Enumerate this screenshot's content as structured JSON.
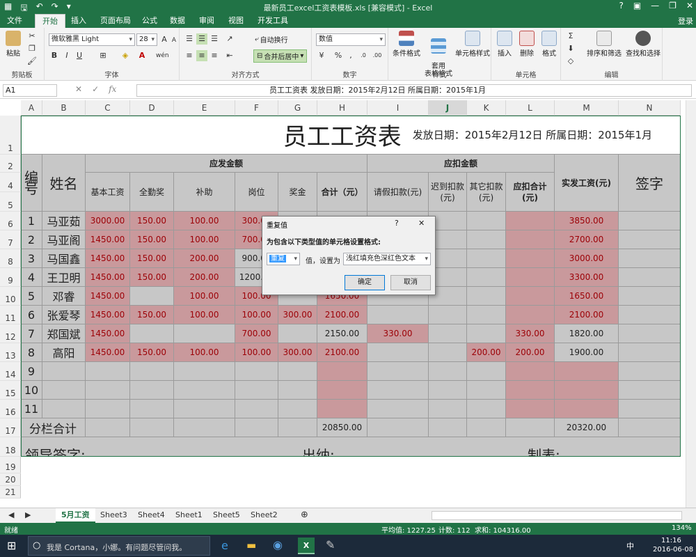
{
  "window": {
    "title": "最新员工excel工资表模板.xls [兼容模式] - Excel",
    "login": "登录"
  },
  "tabs": [
    "开始",
    "插入",
    "页面布局",
    "公式",
    "数据",
    "审阅",
    "视图",
    "开发工具"
  ],
  "file_tab": "文件",
  "ribbon": {
    "clipboard": {
      "label": "剪贴板",
      "paste": "粘贴"
    },
    "font": {
      "label": "字体",
      "name": "微软雅黑 Light",
      "size": "28"
    },
    "alignment": {
      "label": "对齐方式",
      "wrap": "自动换行",
      "merge": "合并后居中"
    },
    "number": {
      "label": "数字",
      "format": "数值"
    },
    "styles": {
      "label": "样式",
      "cond": "条件格式",
      "table": "套用\n表格格式",
      "cell": "单元格样式"
    },
    "cells": {
      "label": "单元格",
      "insert": "插入",
      "delete": "删除",
      "format": "格式"
    },
    "editing": {
      "label": "编辑",
      "sort": "排序和筛选",
      "find": "查找和选择"
    }
  },
  "formula_bar": {
    "namebox": "A1",
    "content": "员工工资表   发放日期：2015年2月12日  所属日期：2015年1月"
  },
  "columns": [
    "A",
    "B",
    "C",
    "D",
    "E",
    "F",
    "G",
    "H",
    "I",
    "J",
    "K",
    "L",
    "M",
    "N"
  ],
  "rows": [
    "1",
    "2",
    "4",
    "5",
    "6",
    "7",
    "8",
    "9",
    "10",
    "11",
    "12",
    "13",
    "14",
    "15",
    "16",
    "17",
    "18",
    "19",
    "20",
    "21"
  ],
  "sheet": {
    "title": "员工工资表",
    "subtitle": "发放日期：2015年2月12日 所属日期：2015年1月",
    "h_id": "编号",
    "h_name": "姓名",
    "h_payable": "应发金额",
    "h_deduct": "应扣金额",
    "h_base": "基本工资",
    "h_attend": "全勤奖",
    "h_subsidy": "补助",
    "h_post": "岗位",
    "h_bonus": "奖金",
    "h_total": "合计（元）",
    "h_leave": "请假扣款(元)",
    "h_late": "迟到扣款(元)",
    "h_other": "其它扣款(元)",
    "h_dtotal": "应扣合计(元)",
    "h_net": "实发工资(元)",
    "h_sign": "签字",
    "sum_label": "分栏合计",
    "sum_total": "20850.00",
    "sum_net": "20320.00",
    "footer": {
      "leader": "领导签字:",
      "cashier": "出纳:",
      "maker": "制表:"
    },
    "data": [
      {
        "id": "1",
        "name": "马亚茹",
        "base": "3000.00",
        "attend": "150.00",
        "subsidy": "100.00",
        "post": "300.00",
        "bonus": "",
        "total": "",
        "leave": "",
        "late": "",
        "other": "",
        "dtotal": "",
        "net": "3850.00"
      },
      {
        "id": "2",
        "name": "马亚阁",
        "base": "1450.00",
        "attend": "150.00",
        "subsidy": "100.00",
        "post": "700.00",
        "bonus": "",
        "total": "",
        "leave": "",
        "late": "",
        "other": "",
        "dtotal": "",
        "net": "2700.00"
      },
      {
        "id": "3",
        "name": "马国鑫",
        "base": "1450.00",
        "attend": "150.00",
        "subsidy": "200.00",
        "post": "900.00",
        "bonus": "",
        "total": "",
        "leave": "",
        "late": "",
        "other": "",
        "dtotal": "",
        "net": "3000.00"
      },
      {
        "id": "4",
        "name": "王卫明",
        "base": "1450.00",
        "attend": "150.00",
        "subsidy": "200.00",
        "post": "1200.00",
        "bonus": "",
        "total": "",
        "leave": "",
        "late": "",
        "other": "",
        "dtotal": "",
        "net": "3300.00"
      },
      {
        "id": "5",
        "name": "邓睿",
        "base": "1450.00",
        "attend": "",
        "subsidy": "100.00",
        "post": "100.00",
        "bonus": "",
        "total": "1650.00",
        "leave": "",
        "late": "",
        "other": "",
        "dtotal": "",
        "net": "1650.00"
      },
      {
        "id": "6",
        "name": "张爱琴",
        "base": "1450.00",
        "attend": "150.00",
        "subsidy": "100.00",
        "post": "100.00",
        "bonus": "300.00",
        "total": "2100.00",
        "leave": "",
        "late": "",
        "other": "",
        "dtotal": "",
        "net": "2100.00"
      },
      {
        "id": "7",
        "name": "郑国斌",
        "base": "1450.00",
        "attend": "",
        "subsidy": "",
        "post": "700.00",
        "bonus": "",
        "total": "2150.00",
        "leave": "330.00",
        "late": "",
        "other": "",
        "dtotal": "330.00",
        "net": "1820.00"
      },
      {
        "id": "8",
        "name": "高阳",
        "base": "1450.00",
        "attend": "150.00",
        "subsidy": "100.00",
        "post": "100.00",
        "bonus": "300.00",
        "total": "2100.00",
        "leave": "",
        "late": "",
        "other": "200.00",
        "dtotal": "200.00",
        "net": "1900.00"
      },
      {
        "id": "9",
        "name": "",
        "base": "",
        "attend": "",
        "subsidy": "",
        "post": "",
        "bonus": "",
        "total": "",
        "leave": "",
        "late": "",
        "other": "",
        "dtotal": "",
        "net": ""
      },
      {
        "id": "10",
        "name": "",
        "base": "",
        "attend": "",
        "subsidy": "",
        "post": "",
        "bonus": "",
        "total": "",
        "leave": "",
        "late": "",
        "other": "",
        "dtotal": "",
        "net": ""
      },
      {
        "id": "11",
        "name": "",
        "base": "",
        "attend": "",
        "subsidy": "",
        "post": "",
        "bonus": "",
        "total": "",
        "leave": "",
        "late": "",
        "other": "",
        "dtotal": "",
        "net": ""
      }
    ]
  },
  "sheet_tabs": [
    "5月工资",
    "Sheet3",
    "Sheet4",
    "Sheet1",
    "Sheet5",
    "Sheet2"
  ],
  "status": {
    "ready": "就绪",
    "avg": "平均值: 1227.25",
    "count": "计数: 112",
    "sum": "求和: 104316.00",
    "zoom": "134%"
  },
  "taskbar": {
    "search": "我是 Cortana，小娜。有问题尽管问我。",
    "time": "11:16",
    "date": "2016-06-08",
    "ime": "中"
  },
  "dialog": {
    "title": "重复值",
    "help": "?",
    "close": "✕",
    "prompt": "为包含以下类型值的单元格设置格式:",
    "type_value": "重复",
    "mid_text": "值，设置为",
    "format_value": "浅红填充色深红色文本",
    "ok": "确定",
    "cancel": "取消"
  },
  "colors": {
    "excel_green": "#217346",
    "dup_fill": "#c9999c",
    "dup_text": "#9c0006"
  }
}
